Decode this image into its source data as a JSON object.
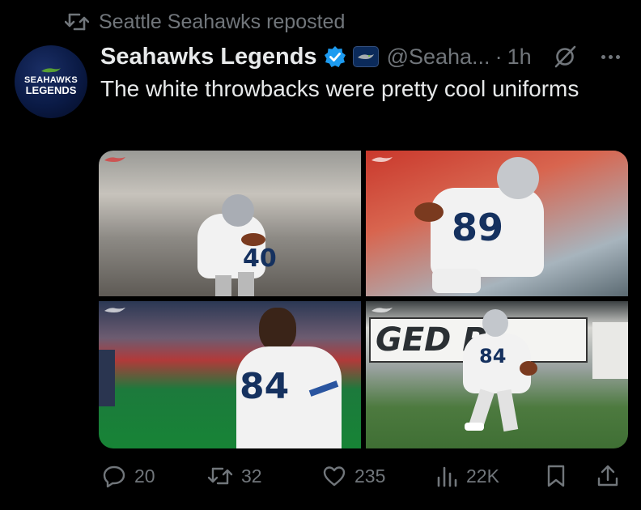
{
  "repost": {
    "text": "Seattle Seahawks reposted",
    "icon": "repost-icon"
  },
  "avatar": {
    "line1": "SEAHAWKS",
    "line2": "LEGENDS"
  },
  "author": {
    "name": "Seahawks Legends",
    "handle": "@Seaha...",
    "separator": "·",
    "time": "1h",
    "verified_color": "#1d9bf0"
  },
  "tweet": {
    "text": "The white throwbacks were pretty cool uniforms"
  },
  "media": {
    "images": [
      {
        "jersey_number": "40"
      },
      {
        "jersey_number": "89"
      },
      {
        "jersey_number": "84"
      },
      {
        "jersey_number": "84"
      }
    ],
    "banner_text": "GED  P!"
  },
  "actions": {
    "replies": "20",
    "reposts": "32",
    "likes": "235",
    "views": "22K"
  },
  "colors": {
    "background": "#000000",
    "text": "#e7e9ea",
    "muted": "#71767b",
    "accent": "#1d9bf0"
  }
}
